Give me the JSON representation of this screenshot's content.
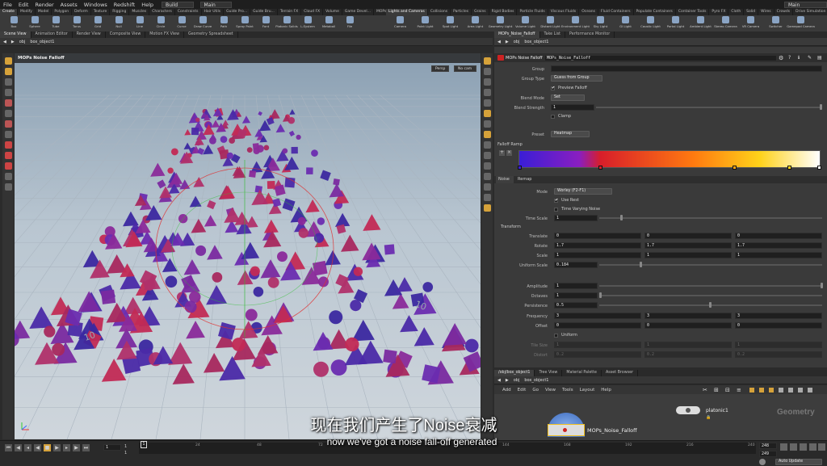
{
  "menu": {
    "items": [
      "File",
      "Edit",
      "Render",
      "Assets",
      "Windows",
      "Redshift",
      "Help"
    ],
    "desktop": "Build",
    "scene": "Main",
    "right_desktop": "Main"
  },
  "shelf_tabs_left": [
    "Create",
    "Modify",
    "Model",
    "Polygon",
    "Deform",
    "Texture",
    "Rigging",
    "Muscles",
    "Characters",
    "Constraints",
    "Hair Utils",
    "Guide Pro...",
    "Guide Bru...",
    "Terrain FX",
    "Cloud FX",
    "Volume",
    "Game Devel...",
    "MOPs"
  ],
  "shelf_tools_left": [
    "Box",
    "Sphere",
    "Tube",
    "Torus",
    "Grid",
    "Null",
    "Line",
    "Circle",
    "Curve",
    "Draw Curve",
    "Path",
    "Spray Paint",
    "Font",
    "Platonic Solids",
    "L-System",
    "Metaball",
    "File"
  ],
  "shelf_tabs_right": [
    "Lights and Cameras",
    "Collisions",
    "Particles",
    "Grains",
    "Rigid Bodies",
    "Particle Fluids",
    "Viscous Fluids",
    "Oceans",
    "Fluid Containers",
    "Populate Containers",
    "Container Tools",
    "Pyro FX",
    "Cloth",
    "Solid",
    "Wires",
    "Crowds",
    "Drive Simulation",
    "Redshift"
  ],
  "shelf_tools_right": [
    "Camera",
    "Point Light",
    "Spot Light",
    "Area Light",
    "Geometry Light",
    "Volume Light",
    "Distant Light",
    "Environment Light",
    "Sky Light",
    "GI Light",
    "Caustic Light",
    "Portal Light",
    "Ambient Light",
    "Stereo Camera",
    "VR Camera",
    "Switcher",
    "Gamepad Camera"
  ],
  "left_tabs": [
    "Scene View",
    "Animation Editor",
    "Render View",
    "Composite View",
    "Motion FX View",
    "Geometry Spreadsheet"
  ],
  "left_path": [
    "obj",
    "box_object1"
  ],
  "viewport": {
    "title": "MOPs Noise Falloff",
    "persp": "Persp",
    "cam": "No cam",
    "grid_label_right": "10",
    "grid_label_left": "10"
  },
  "right_tabs": [
    "MOPs_Noise_Falloff",
    "Take List",
    "Performance Monitor"
  ],
  "right_path": [
    "obj",
    "box_object1"
  ],
  "params": {
    "node_type": "MOPs Noise Falloff",
    "node_name": "MOPs_Noise_Falloff",
    "group_label": "Group",
    "group_value": "",
    "group_type_label": "Group Type",
    "group_type_value": "Guess from Group",
    "preview_falloff": "Preview Falloff",
    "blend_mode_label": "Blend Mode",
    "blend_mode_value": "Set",
    "blend_strength_label": "Blend Strength",
    "blend_strength_value": "1",
    "clamp": "Clamp",
    "preset_label": "Preset",
    "preset_value": "Heatmap",
    "falloff_ramp": "Falloff Ramp",
    "tabs": [
      "Noise",
      "Remap"
    ],
    "mode_label": "Mode",
    "mode_value": "Worley (F2-F1)",
    "use_rest": "Use Rest",
    "time_varying": "Time Varying Noise",
    "time_scale_label": "Time Scale",
    "time_scale_value": "1",
    "transform": "Transform",
    "translate_label": "Translate",
    "translate": [
      "0",
      "0",
      "0"
    ],
    "rotate_label": "Rotate",
    "rotate": [
      "1.7",
      "1.7",
      "1.7"
    ],
    "scale_label": "Scale",
    "scale": [
      "1",
      "1",
      "1"
    ],
    "uniform_scale_label": "Uniform Scale",
    "uniform_scale_value": "0.184",
    "amplitude_label": "Amplitude",
    "amplitude_value": "1",
    "octaves_label": "Octaves",
    "octaves_value": "1",
    "persistence_label": "Persistence",
    "persistence_value": "0.5",
    "frequency_label": "Frequency",
    "frequency": [
      "3",
      "3",
      "3"
    ],
    "offset_label": "Offset",
    "offset": [
      "0",
      "0",
      "0"
    ],
    "uniform": "Uniform",
    "tile_size_label": "Tile Size",
    "tile_size": [
      "1",
      "1",
      "1"
    ],
    "distort_label": "Distort",
    "distort": [
      "0.2",
      "0.2",
      "0.2"
    ]
  },
  "network": {
    "tabs": [
      "/obj/box_object1",
      "Tree View",
      "Material Palette",
      "Asset Browser"
    ],
    "path": [
      "obj",
      "box_object1"
    ],
    "menu": [
      "Add",
      "Edit",
      "Go",
      "View",
      "Tools",
      "Layout",
      "Help"
    ],
    "node1": "MOPs_Noise_Falloff",
    "node2": "platonic1",
    "context": "Geometry"
  },
  "timeline": {
    "frame": "1",
    "start": "1",
    "end": "1",
    "ticks": [
      "24",
      "48",
      "72",
      "96",
      "120",
      "144",
      "168",
      "192",
      "216",
      "240"
    ],
    "range_end": "248",
    "range_end2": "249",
    "auto_update": "Auto Update"
  },
  "subtitle": {
    "cn": "现在我们产生了Noise衰减",
    "en": "now we've got a noise fall-off generated"
  },
  "colors": {
    "ramp_start": "#3a1ed6",
    "ramp_mid": "#d81e2a",
    "ramp_end": "#ffffff",
    "accent": "#e0a020"
  }
}
